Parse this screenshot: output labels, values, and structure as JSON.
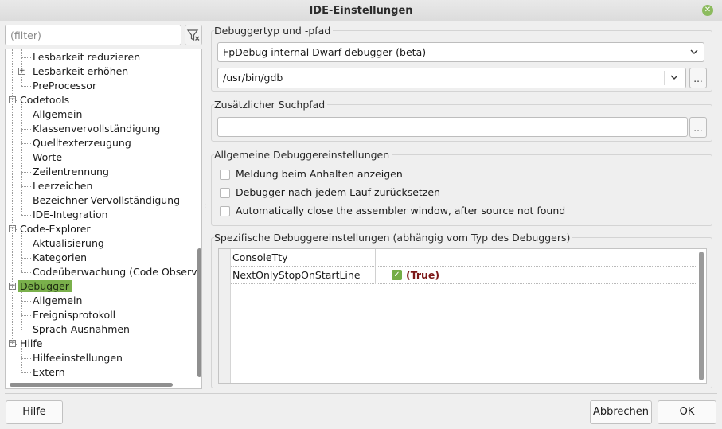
{
  "window": {
    "title": "IDE-Einstellungen",
    "close_glyph": "✕"
  },
  "sidebar": {
    "filter_placeholder": "(filter)",
    "tree": [
      {
        "label": "Lesbarkeit reduzieren",
        "level": 1,
        "expander": ""
      },
      {
        "label": "Lesbarkeit erhöhen",
        "level": 1,
        "expander": "+"
      },
      {
        "label": "PreProcessor",
        "level": 1,
        "expander": ""
      },
      {
        "label": "Codetools",
        "level": 0,
        "expander": "−"
      },
      {
        "label": "Allgemein",
        "level": 1,
        "expander": ""
      },
      {
        "label": "Klassenvervollständigung",
        "level": 1,
        "expander": ""
      },
      {
        "label": "Quelltexterzeugung",
        "level": 1,
        "expander": ""
      },
      {
        "label": "Worte",
        "level": 1,
        "expander": ""
      },
      {
        "label": "Zeilentrennung",
        "level": 1,
        "expander": ""
      },
      {
        "label": "Leerzeichen",
        "level": 1,
        "expander": ""
      },
      {
        "label": "Bezeichner-Vervollständigung",
        "level": 1,
        "expander": ""
      },
      {
        "label": "IDE-Integration",
        "level": 1,
        "expander": ""
      },
      {
        "label": "Code-Explorer",
        "level": 0,
        "expander": "−"
      },
      {
        "label": "Aktualisierung",
        "level": 1,
        "expander": ""
      },
      {
        "label": "Kategorien",
        "level": 1,
        "expander": ""
      },
      {
        "label": "Codeüberwachung (Code Observer)",
        "level": 1,
        "expander": ""
      },
      {
        "label": "Debugger",
        "level": 0,
        "expander": "−",
        "selected": true
      },
      {
        "label": "Allgemein",
        "level": 1,
        "expander": ""
      },
      {
        "label": "Ereignisprotokoll",
        "level": 1,
        "expander": ""
      },
      {
        "label": "Sprach-Ausnahmen",
        "level": 1,
        "expander": ""
      },
      {
        "label": "Hilfe",
        "level": 0,
        "expander": "−"
      },
      {
        "label": "Hilfeeinstellungen",
        "level": 1,
        "expander": ""
      },
      {
        "label": "Extern",
        "level": 1,
        "expander": ""
      }
    ]
  },
  "debugger_type": {
    "title": "Debuggertyp und -pfad",
    "type_value": "FpDebug internal Dwarf-debugger (beta)",
    "path_value": "/usr/bin/gdb",
    "browse_label": "..."
  },
  "extra_path": {
    "title": "Zusätzlicher Suchpfad",
    "value": "",
    "browse_label": "..."
  },
  "general": {
    "title": "Allgemeine Debuggereinstellungen",
    "options": [
      {
        "label": "Meldung beim Anhalten anzeigen",
        "checked": false
      },
      {
        "label": "Debugger nach jedem Lauf zurücksetzen",
        "checked": false
      },
      {
        "label": "Automatically close the assembler window, after source not found",
        "checked": false
      }
    ]
  },
  "specific": {
    "title": "Spezifische Debuggereinstellungen (abhängig vom Typ des Debuggers)",
    "rows": [
      {
        "name": "ConsoleTty",
        "value": ""
      },
      {
        "name": "NextOnlyStopOnStartLine",
        "value": "(True)",
        "check": "✓"
      }
    ]
  },
  "footer": {
    "help_label": "Hilfe",
    "cancel_label": "Abbrechen",
    "ok_label": "OK"
  }
}
